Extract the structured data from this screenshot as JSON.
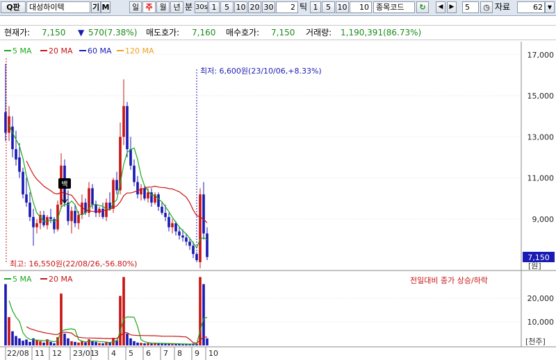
{
  "toolbar": {
    "search_label": "Q",
    "search_sub": "판",
    "stock_name": "대성하이텍",
    "btn_gi": "기",
    "btn_m": "M",
    "periods": [
      "일",
      "주",
      "월",
      "년",
      "분",
      "30s",
      "1",
      "5",
      "10",
      "20",
      "30"
    ],
    "selected_period": "주",
    "tick_value": "2",
    "tick_label": "틱",
    "tick_opts": [
      "1",
      "5",
      "10"
    ],
    "tick_input": "10",
    "code_placeholder": "종목코드",
    "step_value": "5",
    "data_label": "자료",
    "data_count": "62"
  },
  "info": {
    "price_label": "현재가:",
    "price": "7,150",
    "change": "570(7.38%)",
    "ask_label": "매도호가:",
    "ask": "7,160",
    "bid_label": "매수호가:",
    "bid": "7,150",
    "vol_label": "거래량:",
    "volume": "1,190,391(86.73%)"
  },
  "legend": [
    {
      "label": "5 MA",
      "color": "#1aa81a"
    },
    {
      "label": "20 MA",
      "color": "#c81414"
    },
    {
      "label": "60 MA",
      "color": "#1a1ab4"
    },
    {
      "label": "120 MA",
      "color": "#f0a020"
    }
  ],
  "vol_legend": [
    {
      "label": "5 MA",
      "color": "#1aa81a"
    },
    {
      "label": "20 MA",
      "color": "#c81414"
    }
  ],
  "annotations": {
    "low": "최저: 6,600원(23/10/06,+8.33%)",
    "high": "최고: 16,550원(22/08/26,-56.80%)",
    "vol_note": "전일대비 종가 상승/하락",
    "current_price_tag": "7,150",
    "unit_price": "[원]",
    "unit_vol": "[천주]",
    "marker": "백"
  },
  "chart_data": [
    {
      "type": "candlestick",
      "title": "",
      "ylabel": "[원]",
      "ylim": [
        7000,
        17500
      ],
      "y_ticks": [
        "17,000",
        "15,000",
        "13,000",
        "11,000",
        "9,000"
      ],
      "x_ticks": [
        "22/08",
        "11",
        "12",
        "23/01",
        "3",
        "4",
        "5",
        "6",
        "7",
        "8",
        "9",
        "10"
      ],
      "series": [
        {
          "name": "5 MA",
          "approximate": true
        }
      ],
      "candles": [
        {
          "o": 14200,
          "h": 16550,
          "l": 12800,
          "c": 13200
        },
        {
          "o": 13200,
          "h": 14500,
          "l": 12800,
          "c": 14000
        },
        {
          "o": 13500,
          "h": 14000,
          "l": 12000,
          "c": 12400
        },
        {
          "o": 12400,
          "h": 13300,
          "l": 11600,
          "c": 11900
        },
        {
          "o": 12000,
          "h": 12700,
          "l": 11000,
          "c": 11300
        },
        {
          "o": 11300,
          "h": 11500,
          "l": 10000,
          "c": 10200
        },
        {
          "o": 10200,
          "h": 11000,
          "l": 9600,
          "c": 9800
        },
        {
          "o": 9800,
          "h": 10300,
          "l": 8900,
          "c": 9100
        },
        {
          "o": 9100,
          "h": 9500,
          "l": 7700,
          "c": 8600
        },
        {
          "o": 8600,
          "h": 9000,
          "l": 8300,
          "c": 8800
        },
        {
          "o": 8800,
          "h": 9400,
          "l": 8500,
          "c": 9200
        },
        {
          "o": 9200,
          "h": 9400,
          "l": 8600,
          "c": 8700
        },
        {
          "o": 8700,
          "h": 9200,
          "l": 8500,
          "c": 9100
        },
        {
          "o": 9100,
          "h": 9500,
          "l": 8800,
          "c": 9000
        },
        {
          "o": 9000,
          "h": 9100,
          "l": 8300,
          "c": 8500
        },
        {
          "o": 8500,
          "h": 9900,
          "l": 8400,
          "c": 9700
        },
        {
          "o": 9700,
          "h": 12200,
          "l": 9500,
          "c": 11600
        },
        {
          "o": 11600,
          "h": 11900,
          "l": 9600,
          "c": 9800
        },
        {
          "o": 9800,
          "h": 10400,
          "l": 8700,
          "c": 8900
        },
        {
          "o": 8900,
          "h": 9600,
          "l": 8300,
          "c": 9400
        },
        {
          "o": 9400,
          "h": 9700,
          "l": 8600,
          "c": 8800
        },
        {
          "o": 8800,
          "h": 9400,
          "l": 8500,
          "c": 9200
        },
        {
          "o": 9200,
          "h": 10200,
          "l": 9000,
          "c": 9800
        },
        {
          "o": 9800,
          "h": 10000,
          "l": 9200,
          "c": 9300
        },
        {
          "o": 9300,
          "h": 10800,
          "l": 9100,
          "c": 10500
        },
        {
          "o": 10500,
          "h": 10700,
          "l": 9500,
          "c": 9700
        },
        {
          "o": 9700,
          "h": 9900,
          "l": 9100,
          "c": 9300
        },
        {
          "o": 9300,
          "h": 9600,
          "l": 9100,
          "c": 9500
        },
        {
          "o": 9500,
          "h": 9800,
          "l": 9000,
          "c": 9100
        },
        {
          "o": 9100,
          "h": 10000,
          "l": 8900,
          "c": 9800
        },
        {
          "o": 9800,
          "h": 10300,
          "l": 9400,
          "c": 9500
        },
        {
          "o": 9500,
          "h": 11000,
          "l": 9300,
          "c": 10900
        },
        {
          "o": 10900,
          "h": 11300,
          "l": 10200,
          "c": 10400
        },
        {
          "o": 10400,
          "h": 13700,
          "l": 10200,
          "c": 13000
        },
        {
          "o": 13000,
          "h": 15800,
          "l": 12600,
          "c": 14500
        },
        {
          "o": 14500,
          "h": 14700,
          "l": 12000,
          "c": 12400
        },
        {
          "o": 12400,
          "h": 13000,
          "l": 11400,
          "c": 11600
        },
        {
          "o": 11600,
          "h": 11900,
          "l": 10600,
          "c": 10800
        },
        {
          "o": 10800,
          "h": 11100,
          "l": 10000,
          "c": 10200
        },
        {
          "o": 10200,
          "h": 10700,
          "l": 9900,
          "c": 10500
        },
        {
          "o": 10500,
          "h": 10600,
          "l": 9900,
          "c": 10000
        },
        {
          "o": 10000,
          "h": 10500,
          "l": 9800,
          "c": 10300
        },
        {
          "o": 10300,
          "h": 10500,
          "l": 9600,
          "c": 9800
        },
        {
          "o": 9800,
          "h": 10300,
          "l": 9700,
          "c": 10200
        },
        {
          "o": 10200,
          "h": 10300,
          "l": 9400,
          "c": 9600
        },
        {
          "o": 9600,
          "h": 9800,
          "l": 9200,
          "c": 9300
        },
        {
          "o": 9300,
          "h": 9700,
          "l": 8900,
          "c": 9100
        },
        {
          "o": 9100,
          "h": 9300,
          "l": 8400,
          "c": 8600
        },
        {
          "o": 8600,
          "h": 9000,
          "l": 8300,
          "c": 8800
        },
        {
          "o": 8800,
          "h": 8900,
          "l": 8200,
          "c": 8400
        },
        {
          "o": 8400,
          "h": 8600,
          "l": 8000,
          "c": 8200
        },
        {
          "o": 8200,
          "h": 8500,
          "l": 7900,
          "c": 8100
        },
        {
          "o": 8100,
          "h": 8300,
          "l": 7700,
          "c": 7900
        },
        {
          "o": 7900,
          "h": 8100,
          "l": 7500,
          "c": 7700
        },
        {
          "o": 7700,
          "h": 7900,
          "l": 7100,
          "c": 7300
        },
        {
          "o": 7300,
          "h": 7400,
          "l": 6900,
          "c": 7000
        },
        {
          "o": 6900,
          "h": 10500,
          "l": 6600,
          "c": 10200
        },
        {
          "o": 10200,
          "h": 10800,
          "l": 8000,
          "c": 8300
        },
        {
          "o": 8300,
          "h": 8600,
          "l": 7000,
          "c": 7150
        }
      ]
    },
    {
      "type": "bar",
      "title": "",
      "ylabel": "[천주]",
      "y_ticks": [
        "20,000",
        "10,000"
      ],
      "ylim": [
        0,
        30000
      ],
      "values": [
        26000,
        12000,
        6000,
        4000,
        3000,
        2000,
        2500,
        1500,
        3000,
        2200,
        1800,
        1200,
        2600,
        1500,
        900,
        3500,
        22000,
        5000,
        3000,
        1800,
        1500,
        1200,
        1800,
        1300,
        2600,
        2000,
        1500,
        1000,
        900,
        1600,
        1200,
        3200,
        2200,
        21000,
        29000,
        5000,
        3000,
        1800,
        1200,
        1100,
        900,
        1000,
        800,
        1100,
        900,
        700,
        800,
        700,
        900,
        600,
        600,
        500,
        500,
        600,
        800,
        700,
        29000,
        26000,
        3000
      ],
      "up_color": "#c81414",
      "down_color": "#1a1ab4"
    }
  ]
}
